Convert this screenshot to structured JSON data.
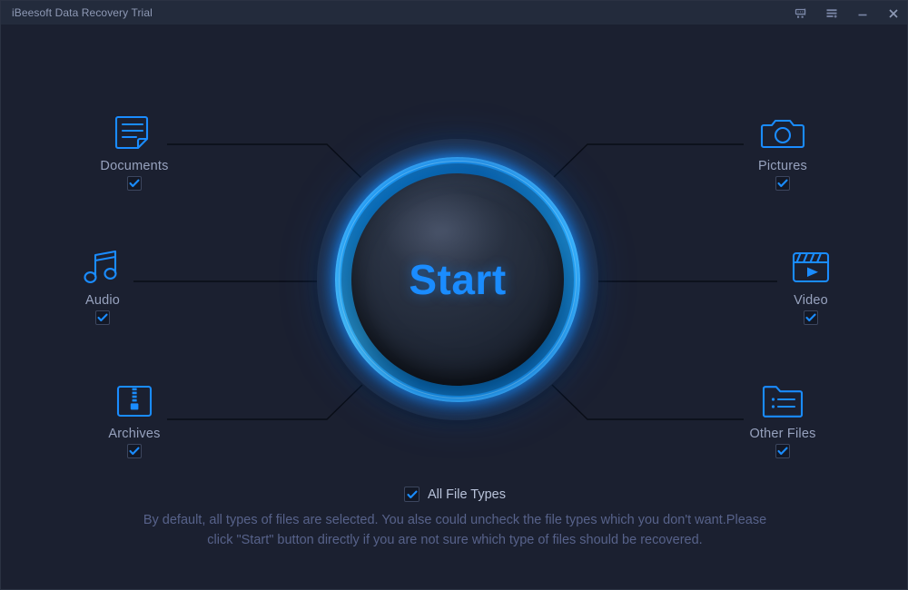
{
  "window": {
    "title": "iBeesoft Data Recovery Trial",
    "accent_color": "#1a8cff",
    "background_color": "#1b2030",
    "titlebar_color": "#232b3c",
    "label_color": "#97a2be"
  },
  "titlebar_actions": [
    {
      "name": "cart-icon",
      "label": "Buy"
    },
    {
      "name": "menu-icon",
      "label": "Menu"
    },
    {
      "name": "minimize-icon",
      "label": "Minimize"
    },
    {
      "name": "close-icon",
      "label": "Close"
    }
  ],
  "start_button": {
    "label": "Start"
  },
  "file_types": [
    {
      "id": "documents",
      "label": "Documents",
      "icon": "document-icon",
      "checked": true
    },
    {
      "id": "audio",
      "label": "Audio",
      "icon": "music-note-icon",
      "checked": true
    },
    {
      "id": "archives",
      "label": "Archives",
      "icon": "archive-icon",
      "checked": true
    },
    {
      "id": "pictures",
      "label": "Pictures",
      "icon": "camera-icon",
      "checked": true
    },
    {
      "id": "video",
      "label": "Video",
      "icon": "clapboard-icon",
      "checked": true
    },
    {
      "id": "other",
      "label": "Other Files",
      "icon": "folder-icon",
      "checked": true
    }
  ],
  "footer": {
    "all_file_types_label": "All File Types",
    "all_file_types_checked": true,
    "description": "By default, all types of files are selected. You alse could uncheck the file types which you don't want.Please click \"Start\" button directly if you are not sure which type of files should be recovered."
  }
}
